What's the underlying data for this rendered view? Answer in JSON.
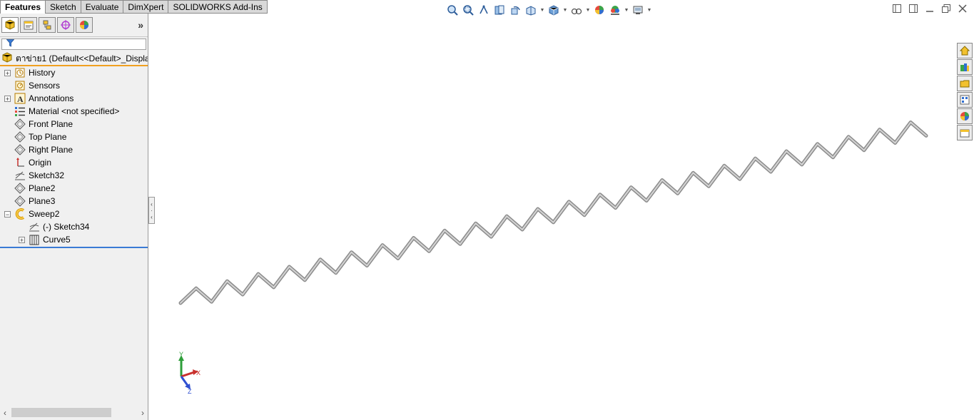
{
  "command_tabs": [
    "Features",
    "Sketch",
    "Evaluate",
    "DimXpert",
    "SOLIDWORKS Add-Ins"
  ],
  "active_tab": "Features",
  "panel": {
    "expand_glyph": "»",
    "root_label": "ตาข่าย1  (Default<<Default>_Displa",
    "tree": [
      {
        "label": "History",
        "icon": "history-icon",
        "expandable": true,
        "indent": 0
      },
      {
        "label": "Sensors",
        "icon": "sensors-icon",
        "expandable": false,
        "indent": 0
      },
      {
        "label": "Annotations",
        "icon": "annotations-icon",
        "expandable": true,
        "indent": 0
      },
      {
        "label": "Material <not specified>",
        "icon": "material-icon",
        "expandable": false,
        "indent": 0
      },
      {
        "label": "Front Plane",
        "icon": "plane-icon",
        "expandable": false,
        "indent": 0
      },
      {
        "label": "Top Plane",
        "icon": "plane-icon",
        "expandable": false,
        "indent": 0
      },
      {
        "label": "Right Plane",
        "icon": "plane-icon",
        "expandable": false,
        "indent": 0
      },
      {
        "label": "Origin",
        "icon": "origin-icon",
        "expandable": false,
        "indent": 0
      },
      {
        "label": "Sketch32",
        "icon": "sketch-icon",
        "expandable": false,
        "indent": 0
      },
      {
        "label": "Plane2",
        "icon": "plane-icon",
        "expandable": false,
        "indent": 0
      },
      {
        "label": "Plane3",
        "icon": "plane-icon",
        "expandable": false,
        "indent": 0
      },
      {
        "label": "Sweep2",
        "icon": "sweep-icon",
        "expandable": true,
        "expanded": true,
        "indent": 0
      },
      {
        "label": "(-) Sketch34",
        "icon": "sketch-icon",
        "expandable": false,
        "indent": 1
      },
      {
        "label": "Curve5",
        "icon": "curve-icon",
        "expandable": true,
        "indent": 1
      }
    ]
  },
  "triad": {
    "x": "X",
    "y": "Y",
    "z": "Z"
  },
  "colors": {
    "tab_bg": "#d9d9d9",
    "panel_bg": "#f0f0f0",
    "root_underline": "#f0a020",
    "model": "#a8a8a8"
  }
}
